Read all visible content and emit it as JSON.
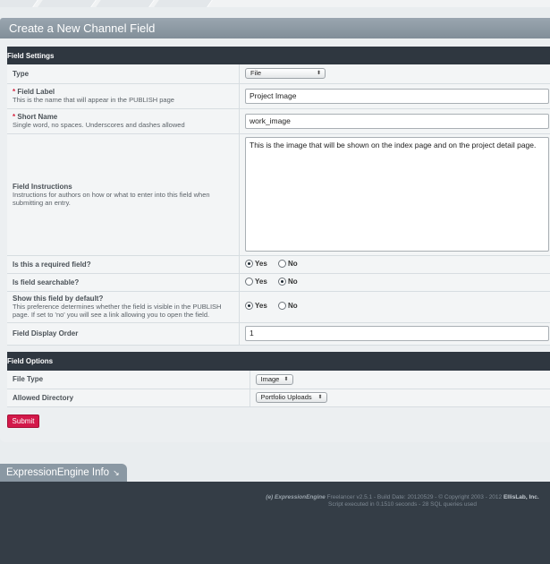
{
  "panel": {
    "title": "Create a New Channel Field"
  },
  "field_settings": {
    "header": "Field Settings",
    "type": {
      "label": "Type",
      "value": "File"
    },
    "field_label": {
      "required_mark": "*",
      "label": "Field Label",
      "sub": "This is the name that will appear in the PUBLISH page",
      "value": "Project Image"
    },
    "short_name": {
      "required_mark": "*",
      "label": "Short Name",
      "sub": "Single word, no spaces. Underscores and dashes allowed",
      "value": "work_image"
    },
    "instructions": {
      "label": "Field Instructions",
      "sub": "Instructions for authors on how or what to enter into this field when submitting an entry.",
      "value": "This is the image that will be shown on the index page and on the project detail page."
    },
    "required": {
      "label": "Is this a required field?",
      "yes": "Yes",
      "no": "No",
      "selected": "Yes"
    },
    "searchable": {
      "label": "Is field searchable?",
      "yes": "Yes",
      "no": "No",
      "selected": "No"
    },
    "show_default": {
      "label": "Show this field by default?",
      "sub": "This preference determines whether the field is visible in the PUBLISH page. If set to 'no' you will see a link allowing you to open the field.",
      "yes": "Yes",
      "no": "No",
      "selected": "Yes"
    },
    "display_order": {
      "label": "Field Display Order",
      "value": "1"
    }
  },
  "field_options": {
    "header": "Field Options",
    "file_type": {
      "label": "File Type",
      "value": "Image"
    },
    "allowed_directory": {
      "label": "Allowed Directory",
      "value": "Portfolio Uploads"
    }
  },
  "submit_label": "Submit",
  "footer": {
    "tab_label": "ExpressionEngine Info",
    "logo_text": "ExpressionEngine",
    "version_text": "Freelancer v2.5.1 - Build Date: 20120529 - © Copyright 2003 - 2012",
    "company": "EllisLab, Inc.",
    "script_text": "Script executed in 0.1510 seconds - 28 SQL queries used"
  },
  "icons": {
    "select_arrow": "updown-arrows-icon",
    "tab_arrow": "arrow-down-right-icon",
    "logo": "ee-logo-icon"
  }
}
